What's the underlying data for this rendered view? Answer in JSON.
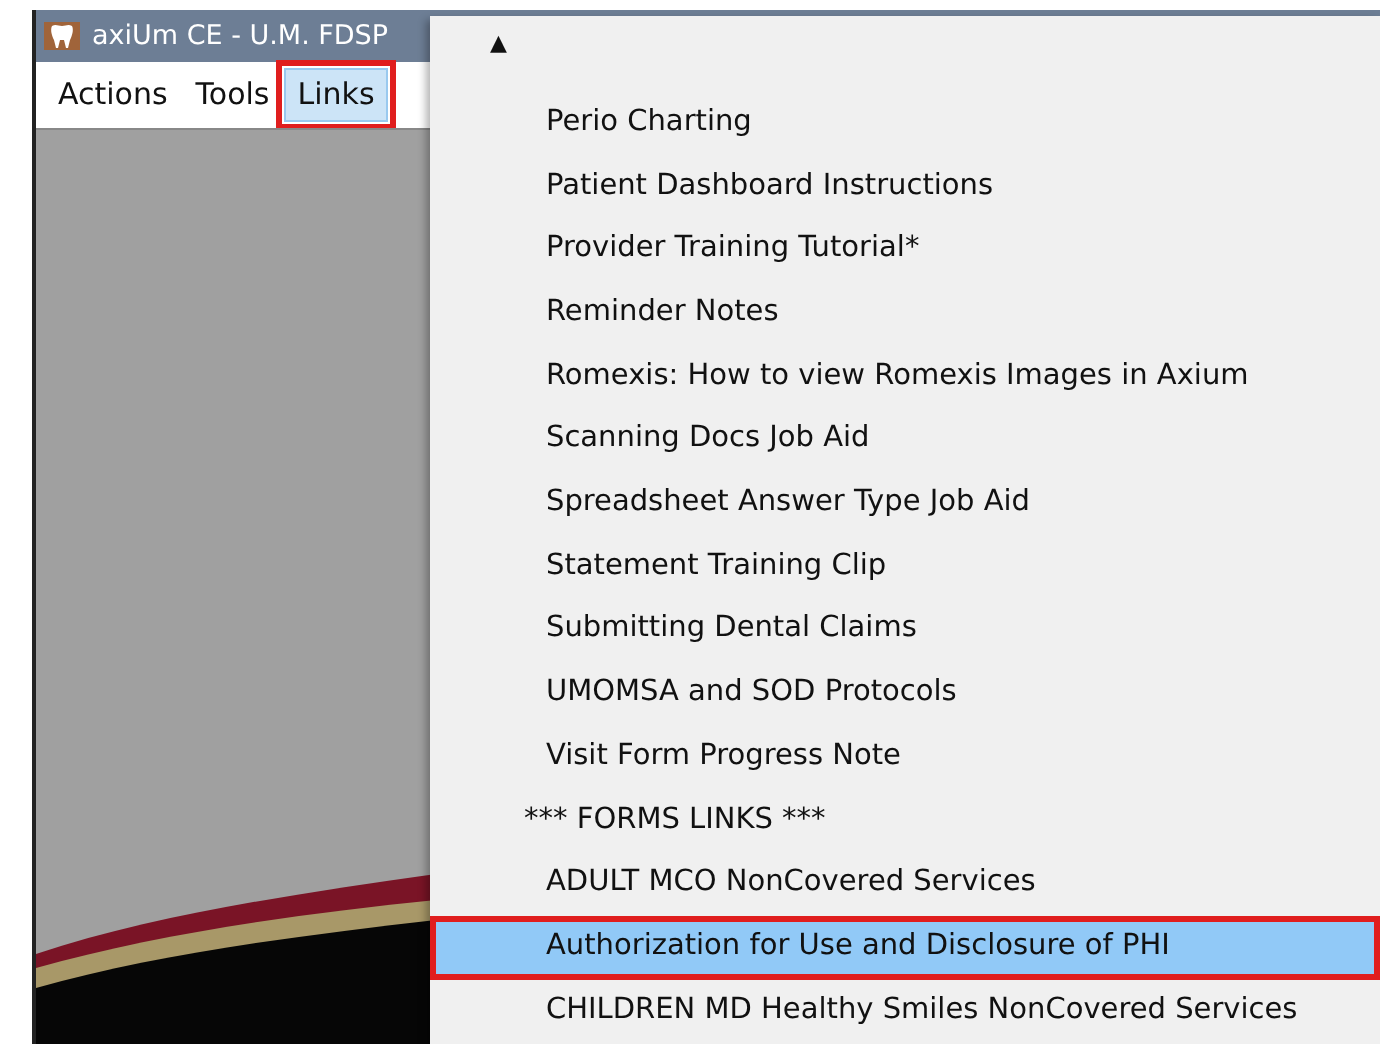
{
  "window": {
    "title": "axiUm CE - U.M. FDSP"
  },
  "menu_bar": [
    {
      "label": "Actions",
      "selected": false,
      "highlighted": false
    },
    {
      "label": "Tools",
      "selected": false,
      "highlighted": false
    },
    {
      "label": "Links",
      "selected": true,
      "highlighted": true
    }
  ],
  "dropdown": {
    "scroll_up": "▲",
    "items": [
      {
        "label": "Perio Charting",
        "kind": "item",
        "selected": false,
        "highlighted": false
      },
      {
        "label": "Patient Dashboard Instructions",
        "kind": "item",
        "selected": false,
        "highlighted": false
      },
      {
        "label": "Provider Training Tutorial*",
        "kind": "item",
        "selected": false,
        "highlighted": false
      },
      {
        "label": "Reminder Notes",
        "kind": "item",
        "selected": false,
        "highlighted": false
      },
      {
        "label": "Romexis: How to view Romexis Images in Axium",
        "kind": "item",
        "selected": false,
        "highlighted": false
      },
      {
        "label": "Scanning Docs Job Aid",
        "kind": "item",
        "selected": false,
        "highlighted": false
      },
      {
        "label": "Spreadsheet Answer Type Job Aid",
        "kind": "item",
        "selected": false,
        "highlighted": false
      },
      {
        "label": "Statement Training Clip",
        "kind": "item",
        "selected": false,
        "highlighted": false
      },
      {
        "label": "Submitting Dental Claims",
        "kind": "item",
        "selected": false,
        "highlighted": false
      },
      {
        "label": "UMOMSA and SOD Protocols",
        "kind": "item",
        "selected": false,
        "highlighted": false
      },
      {
        "label": "Visit Form Progress Note",
        "kind": "item",
        "selected": false,
        "highlighted": false
      },
      {
        "label": "*** FORMS LINKS ***",
        "kind": "heading",
        "selected": false,
        "highlighted": false
      },
      {
        "label": "ADULT MCO NonCovered Services",
        "kind": "item",
        "selected": false,
        "highlighted": false
      },
      {
        "label": "Authorization for Use and Disclosure of PHI",
        "kind": "item",
        "selected": true,
        "highlighted": true
      },
      {
        "label": "CHILDREN MD Healthy Smiles NonCovered Services",
        "kind": "item",
        "selected": false,
        "highlighted": false
      }
    ]
  }
}
